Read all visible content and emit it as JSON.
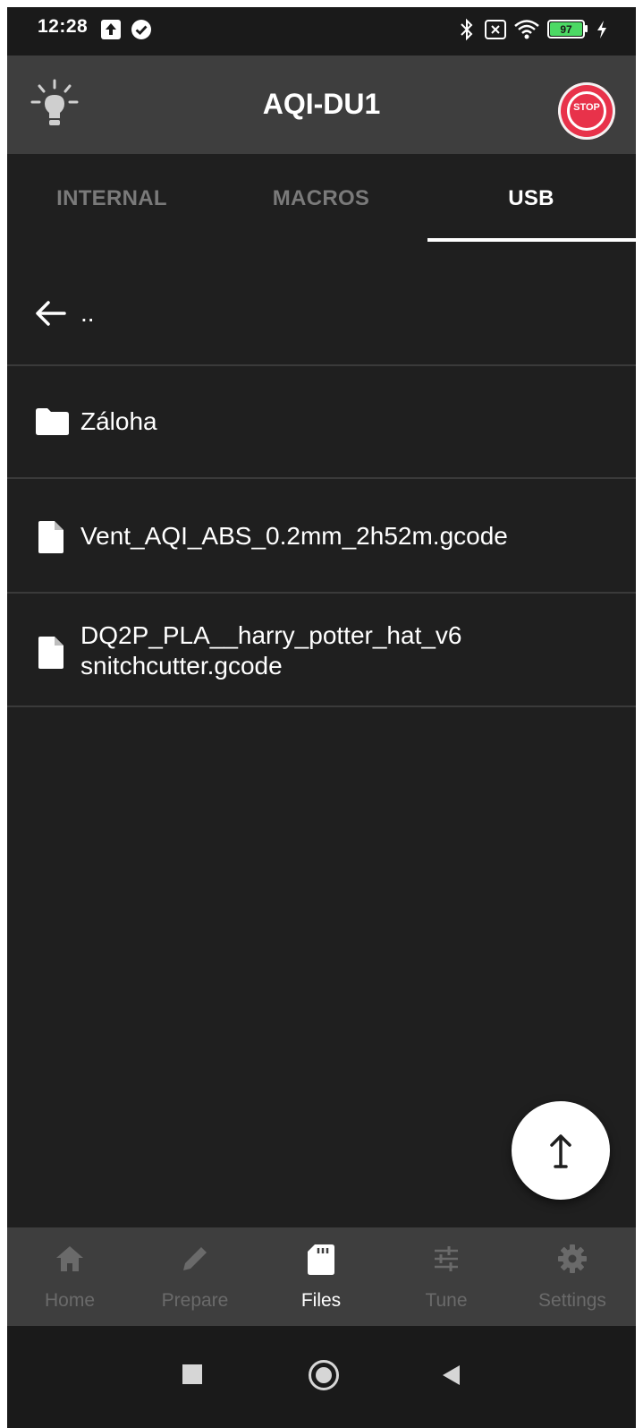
{
  "status_bar": {
    "time": "12:28",
    "battery": "97",
    "icons": [
      "upload-notification-icon",
      "check-circle-icon",
      "bluetooth-icon",
      "sim-off-icon",
      "wifi-icon",
      "battery-icon",
      "charging-icon"
    ]
  },
  "app_bar": {
    "title": "AQI-DU1",
    "stop_label": "STOP",
    "light_icon": "light-bulb-icon"
  },
  "tabs": [
    {
      "label": "INTERNAL",
      "active": false
    },
    {
      "label": "MACROS",
      "active": false
    },
    {
      "label": "USB",
      "active": true
    }
  ],
  "file_list": {
    "back_label": "..",
    "items": [
      {
        "type": "folder",
        "name": "Záloha"
      },
      {
        "type": "file",
        "name": "Vent_AQI_ABS_0.2mm_2h52m.gcode"
      },
      {
        "type": "file",
        "name_line1": "DQ2P_PLA__harry_potter_hat_v6",
        "name_line2": "snitchcutter.gcode"
      }
    ]
  },
  "fab": {
    "icon": "upload-arrow-icon"
  },
  "bottom_nav": [
    {
      "label": "Home",
      "icon": "home-icon",
      "active": false
    },
    {
      "label": "Prepare",
      "icon": "pencil-icon",
      "active": false
    },
    {
      "label": "Files",
      "icon": "sd-card-icon",
      "active": true
    },
    {
      "label": "Tune",
      "icon": "sliders-icon",
      "active": false
    },
    {
      "label": "Settings",
      "icon": "gear-icon",
      "active": false
    }
  ],
  "colors": {
    "background": "#1f1f1f",
    "app_bar": "#3e3e3e",
    "stop_red": "#e8324a",
    "inactive": "#7a7a7a",
    "active": "#ffffff"
  }
}
